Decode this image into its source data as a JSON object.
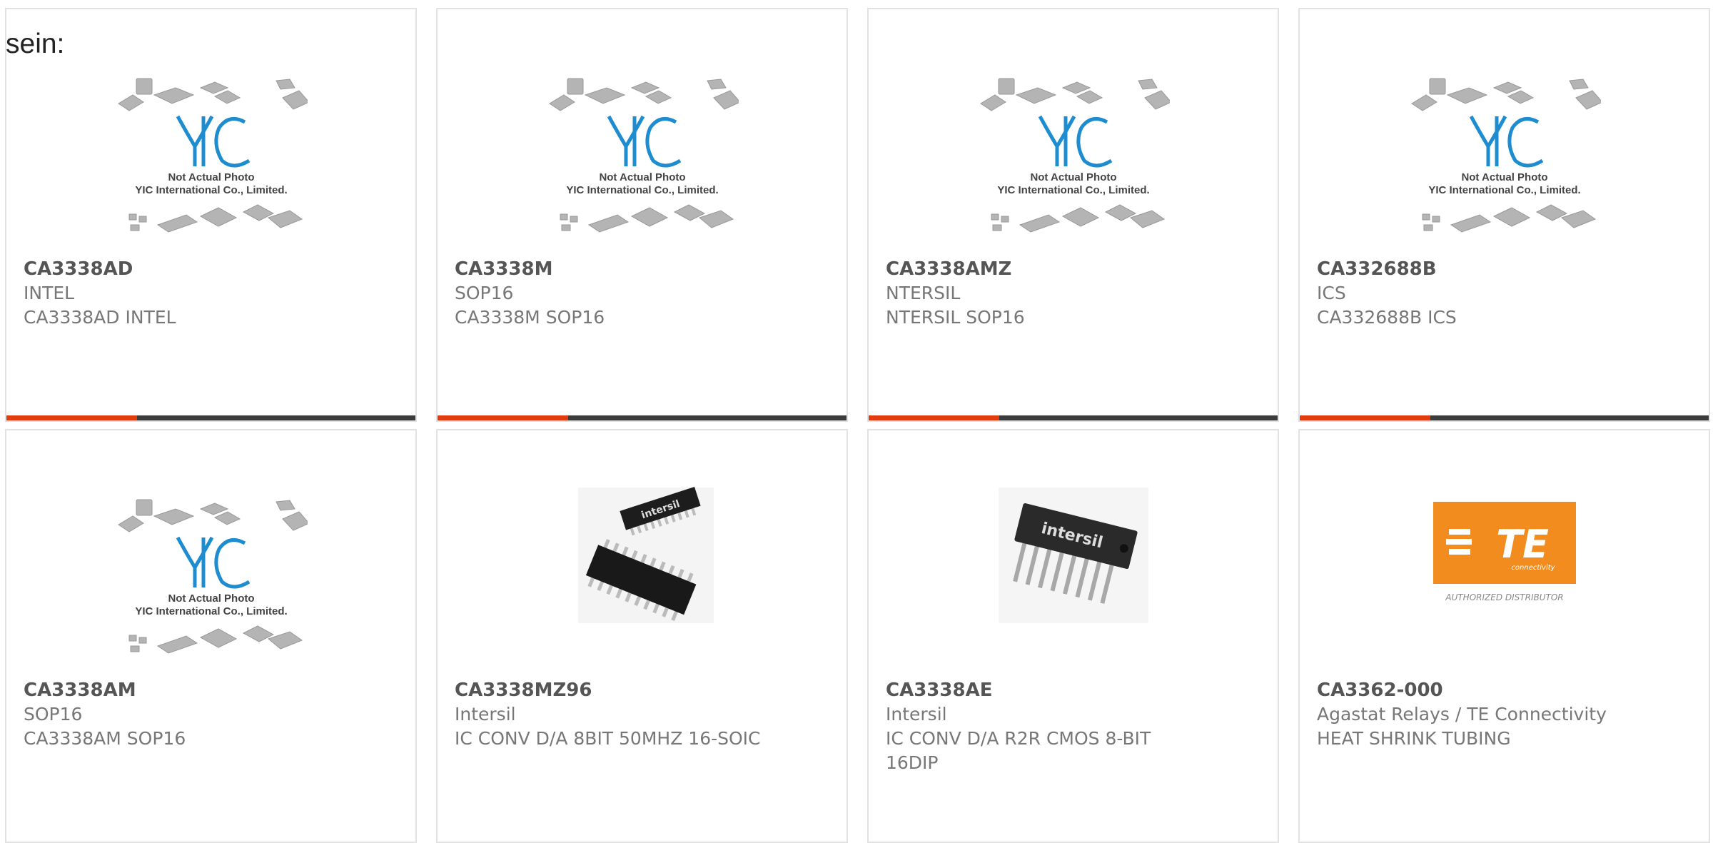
{
  "intro_text": "sein:",
  "colors": {
    "accent": "#e03c10",
    "bar": "#3b3b3b",
    "yic_blue": "#1d8dd0",
    "te_orange": "#f28c1e"
  },
  "placeholder_image": {
    "line1": "Not Actual Photo",
    "line2": "YIC International Co., Limited."
  },
  "te_logo": {
    "wordmark": "TE",
    "tagline": "connectivity",
    "caption": "AUTHORIZED DISTRIBUTOR"
  },
  "products": [
    {
      "part": "CA3338AD",
      "line2": "INTEL",
      "line3": "CA3338AD INTEL",
      "image": "yic-placeholder"
    },
    {
      "part": "CA3338M",
      "line2": "SOP16",
      "line3": "CA3338M SOP16",
      "image": "yic-placeholder"
    },
    {
      "part": "CA3338AMZ",
      "line2": "NTERSIL",
      "line3": "NTERSIL SOP16",
      "image": "yic-placeholder"
    },
    {
      "part": "CA332688B",
      "line2": "ICS",
      "line3": "CA332688B ICS",
      "image": "yic-placeholder"
    },
    {
      "part": "CA3338AM",
      "line2": "SOP16",
      "line3": "CA3338AM SOP16",
      "image": "yic-placeholder"
    },
    {
      "part": "CA3338MZ96",
      "line2": "Intersil",
      "line3": "IC CONV D/A 8BIT 50MHZ 16-SOIC",
      "image": "intersil-soic",
      "chip_label": "intersil"
    },
    {
      "part": "CA3338AE",
      "line2": "Intersil",
      "line3": "IC CONV D/A R2R CMOS 8-BIT 16DIP",
      "image": "intersil-dip",
      "chip_label": "intersil"
    },
    {
      "part": "CA3362-000",
      "line2": "Agastat Relays / TE Connectivity",
      "line3": "HEAT SHRINK TUBING",
      "image": "te-logo"
    }
  ]
}
